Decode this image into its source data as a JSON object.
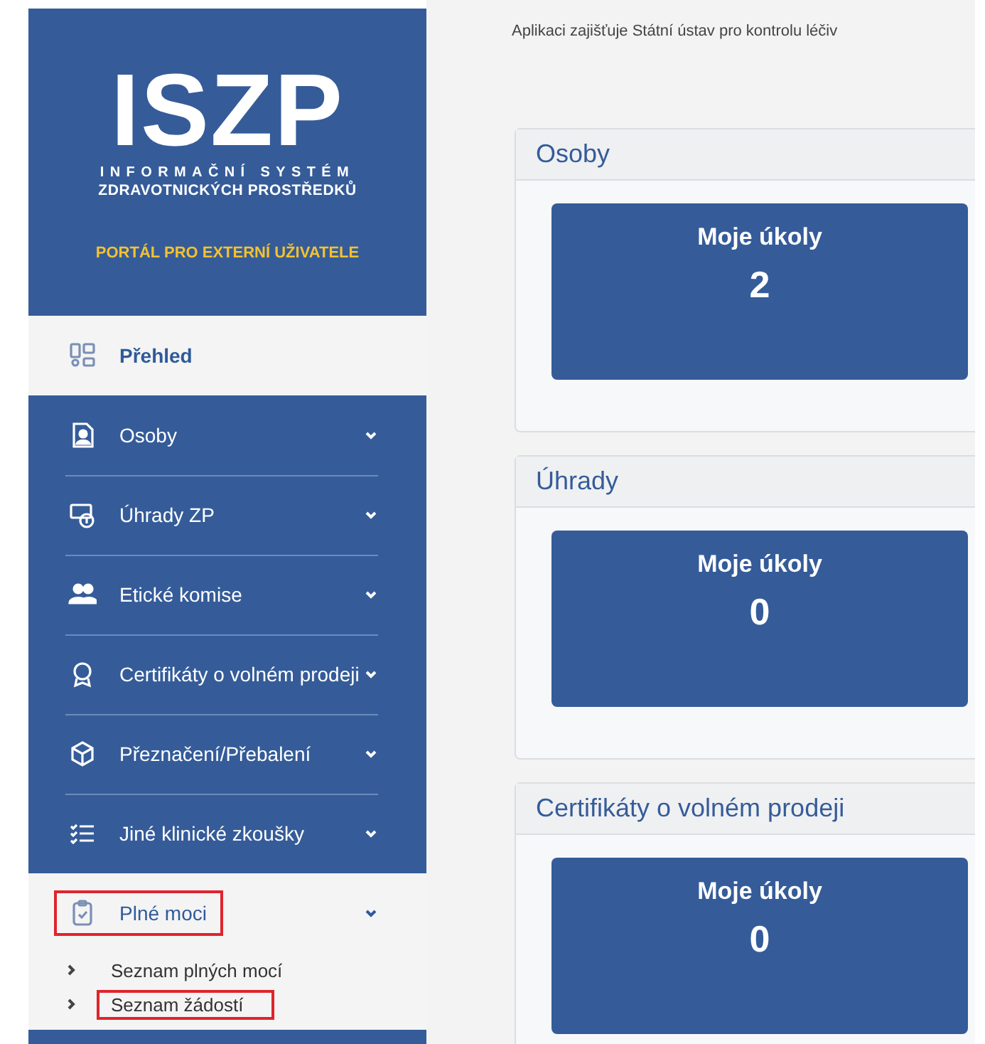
{
  "logo": {
    "title": "ISZP",
    "subtitle_1": "INFORMAČNÍ SYSTÉM",
    "subtitle_2": "ZDRAVOTNICKÝCH PROSTŘEDKŮ",
    "portal": "PORTÁL PRO EXTERNÍ UŽIVATELE"
  },
  "sidebar": {
    "items": [
      {
        "label": "Přehled",
        "selected": true,
        "expandable": false,
        "expanded": false,
        "highlighted": false
      },
      {
        "label": "Osoby",
        "selected": false,
        "expandable": true,
        "expanded": false,
        "highlighted": false
      },
      {
        "label": "Úhrady ZP",
        "selected": false,
        "expandable": true,
        "expanded": false,
        "highlighted": false
      },
      {
        "label": "Etické komise",
        "selected": false,
        "expandable": true,
        "expanded": false,
        "highlighted": false
      },
      {
        "label": "Certifikáty o volném prodeji",
        "selected": false,
        "expandable": true,
        "expanded": false,
        "highlighted": false
      },
      {
        "label": "Přeznačení/Přebalení",
        "selected": false,
        "expandable": true,
        "expanded": false,
        "highlighted": false
      },
      {
        "label": "Jiné klinické zkoušky",
        "selected": false,
        "expandable": true,
        "expanded": false,
        "highlighted": false
      },
      {
        "label": "Plné moci",
        "selected": false,
        "expandable": true,
        "expanded": true,
        "highlighted": true,
        "children": [
          {
            "label": "Seznam plných mocí",
            "highlighted": false
          },
          {
            "label": "Seznam žádostí",
            "highlighted": true
          }
        ]
      }
    ]
  },
  "main": {
    "notice": "Aplikaci zajišťuje Státní ústav pro kontrolu léčiv",
    "panels": [
      {
        "title": "Osoby",
        "tile": {
          "label": "Moje úkoly",
          "count": "2"
        }
      },
      {
        "title": "Úhrady",
        "tile": {
          "label": "Moje úkoly",
          "count": "0"
        }
      },
      {
        "title": "Certifikáty o volném prodeji",
        "tile": {
          "label": "Moje úkoly",
          "count": "0"
        }
      }
    ]
  }
}
